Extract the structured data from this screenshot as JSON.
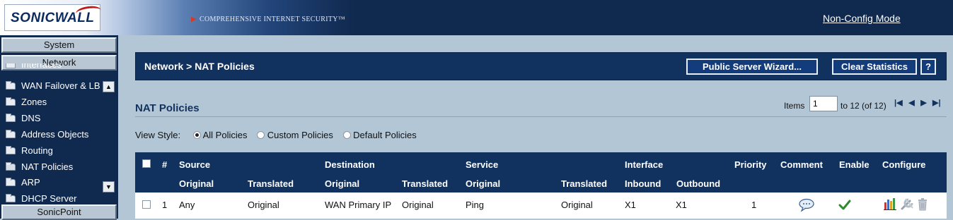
{
  "header": {
    "logo": "SONICWALL",
    "tagline": "COMPREHENSIVE INTERNET SECURITY™",
    "mode_link": "Non-Config Mode"
  },
  "sidebar": {
    "sections": [
      "System",
      "Network",
      "SonicPoint"
    ],
    "items": [
      {
        "label": "Interfaces",
        "icon": "folder-icon"
      },
      {
        "label": "WAN Failover & LB",
        "icon": "folder-icon"
      },
      {
        "label": "Zones",
        "icon": "folder-icon"
      },
      {
        "label": "DNS",
        "icon": "folder-icon"
      },
      {
        "label": "Address Objects",
        "icon": "folder-icon"
      },
      {
        "label": "Routing",
        "icon": "folder-icon"
      },
      {
        "label": "NAT Policies",
        "icon": "folder-open-icon"
      },
      {
        "label": "ARP",
        "icon": "folder-icon"
      },
      {
        "label": "DHCP Server",
        "icon": "folder-icon"
      }
    ]
  },
  "page": {
    "breadcrumb": "Network > NAT Policies",
    "buttons": {
      "wizard": "Public Server Wizard...",
      "clear": "Clear Statistics",
      "help": "?"
    },
    "section_title": "NAT Policies",
    "items": {
      "label": "Items",
      "value": "1",
      "range": "to 12 (of 12)"
    },
    "view_style": {
      "label": "View Style:",
      "options": [
        "All Policies",
        "Custom Policies",
        "Default Policies"
      ],
      "selected": "All Policies"
    }
  },
  "table": {
    "group_headers": [
      "#",
      "Source",
      "Destination",
      "Service",
      "Interface",
      "Priority",
      "Comment",
      "Enable",
      "Configure"
    ],
    "sub_headers": [
      "Original",
      "Translated",
      "Original",
      "Translated",
      "Original",
      "Translated",
      "Inbound",
      "Outbound"
    ],
    "rows": [
      {
        "num": "1",
        "src_original": "Any",
        "src_translated": "Original",
        "dst_original": "WAN Primary IP",
        "dst_translated": "Original",
        "svc_original": "Ping",
        "svc_translated": "Original",
        "inbound": "X1",
        "outbound": "X1",
        "priority": "1",
        "enabled": true
      }
    ]
  },
  "colors": {
    "header_bg": "#10294f",
    "table_header_bg": "#11325f",
    "page_bg": "#b3c6d6",
    "button_bg": "#133c7d"
  }
}
